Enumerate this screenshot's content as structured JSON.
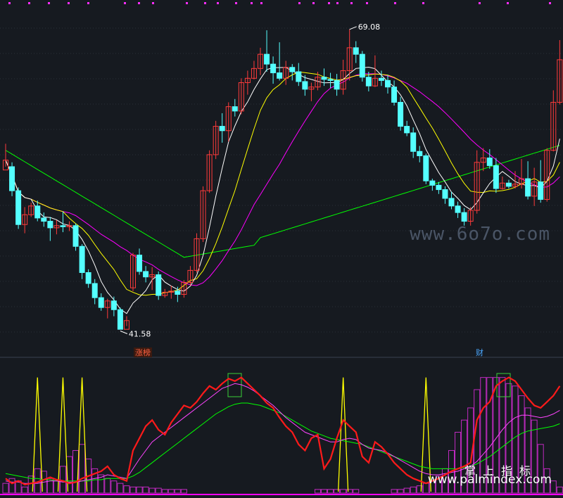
{
  "chart_data": [
    {
      "type": "candlestick",
      "panel": "price",
      "annotations": {
        "high_label": "69.08",
        "low_label": "41.58",
        "event_1": "涨榜",
        "event_2": "财"
      },
      "ylim": [
        40,
        71
      ],
      "candles": [
        [
          56.2,
          57.1,
          56.5,
          58.6
        ],
        [
          56.5,
          54.3,
          53.8,
          56.9
        ],
        [
          54.3,
          51.2,
          50.8,
          54.6
        ],
        [
          51.2,
          52.1,
          50.4,
          52.8
        ],
        [
          52.1,
          52.9,
          51.9,
          53.2
        ],
        [
          52.9,
          51.8,
          51.5,
          53.4
        ],
        [
          51.8,
          51.5,
          51.0,
          52.3
        ],
        [
          51.5,
          50.9,
          49.7,
          51.9
        ],
        [
          50.9,
          51.1,
          50.3,
          51.6
        ],
        [
          51.1,
          51.0,
          50.5,
          52.4
        ],
        [
          51.0,
          51.1,
          50.6,
          51.5
        ],
        [
          51.1,
          49.2,
          48.8,
          51.3
        ],
        [
          49.2,
          46.8,
          46.2,
          49.4
        ],
        [
          46.8,
          45.8,
          45.4,
          47.1
        ],
        [
          45.8,
          44.5,
          43.9,
          46.2
        ],
        [
          44.5,
          43.6,
          43.3,
          44.9
        ],
        [
          43.6,
          44.2,
          42.6,
          44.4
        ],
        [
          44.2,
          43.4,
          42.8,
          44.6
        ],
        [
          43.4,
          41.6,
          41.58,
          43.6
        ],
        [
          41.6,
          42.4,
          41.9,
          42.8
        ],
        [
          45.4,
          48.4,
          45.1,
          48.6
        ],
        [
          48.4,
          46.9,
          46.6,
          49.0
        ],
        [
          46.9,
          46.4,
          45.9,
          47.4
        ],
        [
          46.4,
          46.6,
          45.2,
          47.3
        ],
        [
          46.6,
          44.7,
          44.3,
          46.9
        ],
        [
          44.7,
          45.0,
          44.5,
          45.3
        ],
        [
          45.0,
          45.1,
          44.4,
          45.6
        ],
        [
          45.1,
          44.8,
          44.1,
          45.5
        ],
        [
          44.8,
          45.9,
          44.5,
          46.1
        ],
        [
          45.9,
          47.0,
          45.6,
          47.4
        ],
        [
          47.0,
          49.9,
          46.8,
          50.4
        ],
        [
          49.9,
          54.3,
          49.6,
          54.7
        ],
        [
          54.3,
          57.6,
          54.1,
          58.0
        ],
        [
          57.6,
          60.2,
          57.2,
          60.7
        ],
        [
          60.2,
          59.8,
          58.7,
          61.4
        ],
        [
          59.8,
          62.0,
          58.8,
          62.4
        ],
        [
          62.0,
          61.6,
          61.1,
          62.7
        ],
        [
          61.6,
          64.2,
          61.3,
          64.6
        ],
        [
          64.2,
          64.6,
          63.1,
          65.3
        ],
        [
          64.6,
          65.5,
          64.5,
          66.2
        ],
        [
          65.5,
          66.8,
          64.9,
          67.4
        ],
        [
          66.8,
          65.9,
          65.2,
          69.0
        ],
        [
          65.9,
          65.1,
          64.1,
          66.6
        ],
        [
          65.1,
          64.6,
          64.4,
          67.9
        ],
        [
          64.6,
          65.6,
          64.0,
          66.2
        ],
        [
          65.6,
          65.2,
          64.4,
          65.9
        ],
        [
          65.2,
          64.3,
          63.9,
          66.0
        ],
        [
          64.3,
          63.6,
          63.0,
          64.9
        ],
        [
          63.6,
          63.8,
          62.5,
          64.2
        ],
        [
          63.8,
          64.7,
          63.5,
          65.2
        ],
        [
          64.7,
          64.5,
          63.9,
          65.5
        ],
        [
          64.5,
          64.4,
          63.7,
          65.1
        ],
        [
          64.4,
          63.6,
          63.0,
          65.0
        ],
        [
          63.6,
          65.3,
          63.1,
          66.3
        ],
        [
          65.3,
          67.4,
          64.4,
          69.08
        ],
        [
          67.4,
          66.8,
          66.0,
          68.0
        ],
        [
          66.8,
          64.7,
          64.3,
          67.1
        ],
        [
          64.7,
          63.9,
          63.4,
          65.2
        ],
        [
          63.9,
          64.6,
          63.8,
          66.7
        ],
        [
          64.6,
          64.4,
          63.9,
          65.3
        ],
        [
          64.4,
          63.8,
          63.2,
          64.9
        ],
        [
          63.8,
          62.4,
          62.1,
          64.4
        ],
        [
          62.4,
          60.2,
          59.8,
          62.9
        ],
        [
          60.2,
          59.6,
          59.3,
          60.7
        ],
        [
          59.6,
          57.9,
          57.3,
          60.1
        ],
        [
          57.9,
          57.5,
          56.9,
          58.4
        ],
        [
          57.5,
          55.2,
          54.9,
          57.7
        ],
        [
          55.2,
          54.8,
          54.3,
          55.4
        ],
        [
          54.8,
          54.4,
          54.0,
          55.1
        ],
        [
          54.4,
          53.6,
          53.1,
          54.7
        ],
        [
          53.6,
          52.9,
          52.6,
          54.2
        ],
        [
          52.9,
          52.3,
          51.8,
          53.3
        ],
        [
          52.3,
          51.5,
          51.1,
          52.7
        ],
        [
          51.5,
          52.5,
          51.1,
          52.8
        ],
        [
          52.5,
          56.9,
          52.2,
          58.0
        ],
        [
          56.9,
          57.3,
          56.1,
          58.2
        ],
        [
          57.3,
          56.6,
          56.3,
          58.1
        ],
        [
          56.6,
          54.5,
          54.1,
          57.3
        ],
        [
          54.5,
          55.0,
          54.4,
          55.6
        ],
        [
          55.0,
          54.7,
          54.5,
          55.3
        ],
        [
          54.7,
          54.9,
          54.5,
          56.1
        ],
        [
          54.9,
          55.4,
          54.5,
          57.2
        ],
        [
          55.4,
          53.8,
          53.5,
          57.0
        ],
        [
          53.8,
          55.1,
          52.9,
          56.4
        ],
        [
          55.1,
          53.5,
          53.2,
          57.1
        ],
        [
          53.5,
          58.0,
          53.3,
          58.2
        ],
        [
          58.0,
          62.4,
          57.9,
          63.5
        ],
        [
          62.4,
          66.3,
          62.2,
          68.1
        ]
      ],
      "ma_colors": {
        "ma5": "#ffffff",
        "ma10": "#ffff00",
        "ma20": "#ff00ff",
        "ma60": "#00ff00"
      }
    },
    {
      "type": "indicator",
      "panel": "oscillator",
      "red_line": [
        12,
        8,
        10,
        7,
        8,
        9,
        11,
        13,
        11,
        10,
        8,
        9,
        12,
        14,
        16,
        18,
        22,
        15,
        12,
        10,
        35,
        45,
        55,
        60,
        52,
        48,
        58,
        65,
        72,
        70,
        75,
        82,
        88,
        85,
        90,
        94,
        92,
        95,
        90,
        85,
        80,
        74,
        70,
        62,
        55,
        50,
        40,
        35,
        45,
        48,
        20,
        28,
        45,
        60,
        55,
        50,
        30,
        25,
        42,
        38,
        32,
        25,
        20,
        15,
        12,
        10,
        8,
        10,
        12,
        15,
        18,
        20,
        22,
        25,
        60,
        70,
        75,
        88,
        92,
        95,
        92,
        85,
        78,
        72,
        70,
        75,
        80,
        88
      ],
      "magenta_line": [
        10,
        9,
        9,
        8,
        8,
        8,
        9,
        10,
        10,
        9,
        9,
        9,
        10,
        11,
        12,
        13,
        15,
        14,
        13,
        12,
        20,
        28,
        35,
        42,
        46,
        50,
        54,
        58,
        62,
        66,
        70,
        74,
        78,
        82,
        86,
        88,
        90,
        89,
        87,
        84,
        80,
        76,
        72,
        67,
        62,
        58,
        54,
        50,
        48,
        46,
        44,
        42,
        42,
        44,
        45,
        44,
        40,
        37,
        36,
        35,
        33,
        30,
        27,
        24,
        21,
        18,
        16,
        15,
        15,
        16,
        17,
        18,
        20,
        22,
        26,
        32,
        38,
        45,
        52,
        58,
        62,
        64,
        64,
        63,
        62,
        63,
        65,
        68
      ],
      "green_line": [
        16,
        15,
        14,
        13,
        12,
        12,
        11,
        11,
        10,
        10,
        10,
        10,
        10,
        10,
        11,
        11,
        12,
        12,
        12,
        12,
        14,
        17,
        21,
        25,
        29,
        33,
        37,
        41,
        45,
        49,
        53,
        57,
        61,
        65,
        68,
        71,
        73,
        74,
        74,
        73,
        72,
        70,
        68,
        66,
        63,
        60,
        57,
        54,
        51,
        49,
        47,
        45,
        44,
        43,
        42,
        41,
        40,
        38,
        36,
        34,
        32,
        30,
        28,
        26,
        24,
        22,
        21,
        20,
        20,
        20,
        20,
        20,
        21,
        22,
        24,
        27,
        30,
        34,
        38,
        42,
        46,
        49,
        51,
        52,
        53,
        54,
        55,
        57
      ],
      "yellow_spikes": [
        5,
        9,
        12,
        53,
        66
      ],
      "bars": [
        8,
        12,
        10,
        5,
        14,
        20,
        18,
        12,
        10,
        22,
        30,
        35,
        40,
        28,
        20,
        15,
        12,
        10,
        8,
        6,
        5,
        5,
        5,
        4,
        4,
        3,
        3,
        3,
        3,
        2,
        2,
        2,
        2,
        2,
        2,
        2,
        2,
        2,
        2,
        2,
        2,
        2,
        2,
        2,
        2,
        2,
        2,
        2,
        2,
        3,
        3,
        3,
        3,
        3,
        3,
        3,
        2,
        2,
        2,
        2,
        2,
        3,
        3,
        4,
        5,
        6,
        8,
        10,
        14,
        20,
        35,
        50,
        60,
        70,
        85,
        95,
        95,
        95,
        95,
        90,
        88,
        80,
        70,
        60,
        40,
        20,
        10,
        5
      ]
    }
  ]
}
